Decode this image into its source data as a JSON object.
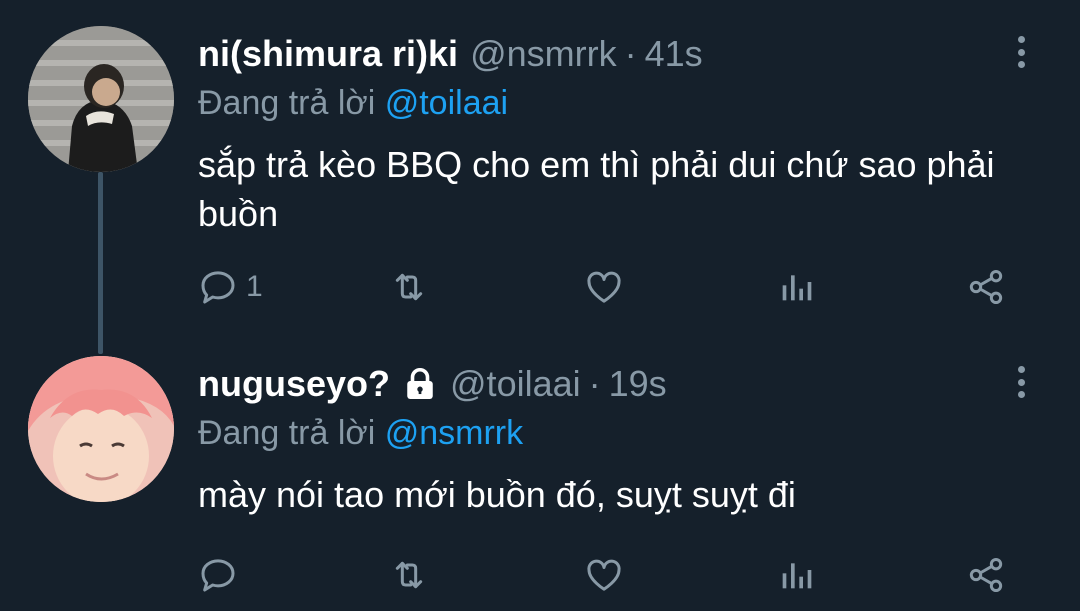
{
  "colors": {
    "background": "#15202b",
    "muted": "#8899a6",
    "mention": "#1da1f2",
    "thread_line": "#3d5466"
  },
  "tweets": [
    {
      "display_name": "ni(shimura ri)ki",
      "handle": "@nsmrrk",
      "separator": "·",
      "time": "41s",
      "replying_prefix": "Đang trả lời",
      "replying_to": "@toilaai",
      "text": "sắp trả kèo BBQ cho em thì phải dui chứ sao phải buồn",
      "reply_count": "1",
      "protected": false
    },
    {
      "display_name": "nuguseyo?",
      "handle": "@toilaai",
      "separator": "·",
      "time": "19s",
      "replying_prefix": "Đang trả lời",
      "replying_to": "@nsmrrk",
      "text": "mày nói tao mới buồn đó, suỵt suỵt đi",
      "reply_count": "",
      "protected": true
    }
  ],
  "icons": [
    "more-vertical-icon",
    "reply-icon",
    "retweet-icon",
    "like-icon",
    "analytics-icon",
    "share-icon",
    "lock-icon"
  ]
}
